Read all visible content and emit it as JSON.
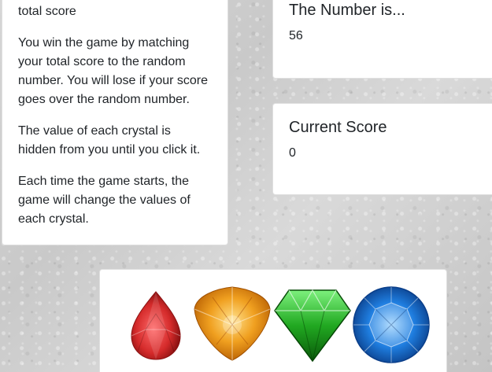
{
  "instructions": {
    "paragraphs": [
      "total score",
      "You win the game by matching your total score to the random number. You will lose if your score goes over the random number.",
      "The value of each crystal is hidden from you until you click it.",
      "Each time the game starts, the game will change the values of each crystal."
    ]
  },
  "target": {
    "title": "The Number is...",
    "value": "56"
  },
  "score": {
    "title": "Current Score",
    "value": "0"
  },
  "crystals": [
    {
      "name": "red-crystal-icon",
      "color": "#d42a2a"
    },
    {
      "name": "orange-crystal-icon",
      "color": "#f0a020"
    },
    {
      "name": "green-crystal-icon",
      "color": "#21a821"
    },
    {
      "name": "blue-crystal-icon",
      "color": "#1f7ee0"
    }
  ]
}
